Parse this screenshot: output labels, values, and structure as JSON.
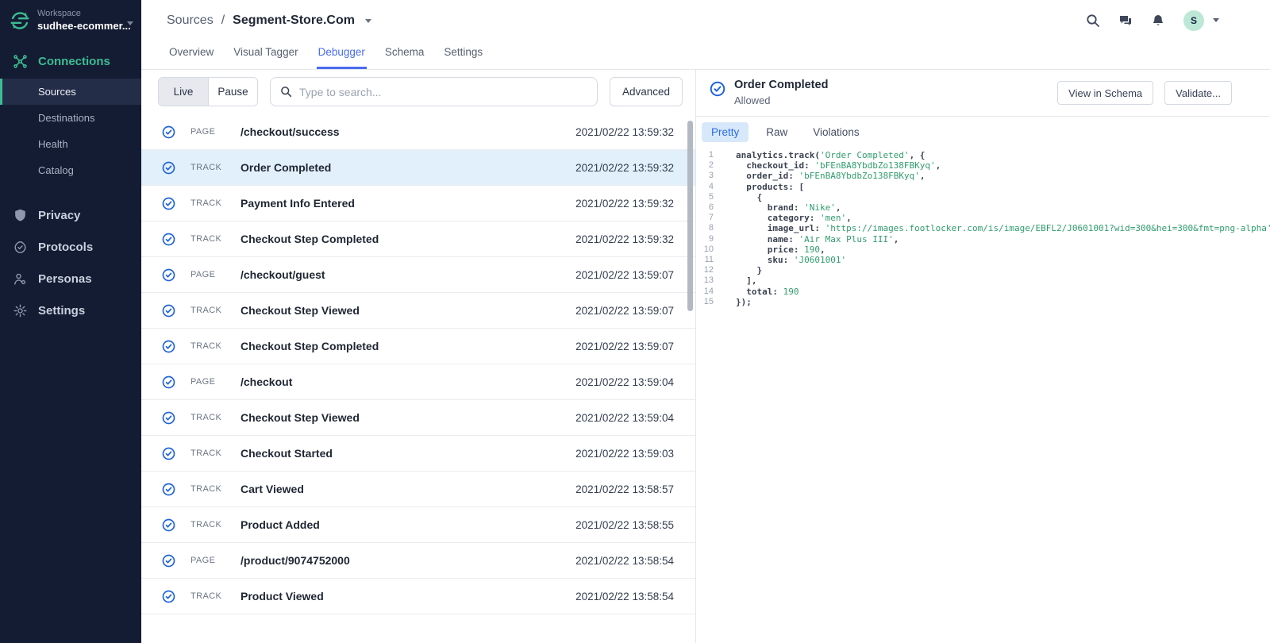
{
  "colors": {
    "sidebar_bg": "#141c33",
    "accent_green": "#3bbd92",
    "accent_blue": "#4a6cf0",
    "event_icon_blue": "#2064d8",
    "selected_row_bg": "#e2f0fb",
    "code_string_green": "#2f9d6c",
    "avatar_bg": "#bde7d6"
  },
  "sidebar": {
    "workspace_label": "Workspace",
    "workspace_name": "sudhee-ecommer...",
    "sections": [
      {
        "icon": "connections-icon",
        "label": "Connections",
        "active": true,
        "children": [
          {
            "label": "Sources",
            "selected": true
          },
          {
            "label": "Destinations"
          },
          {
            "label": "Health"
          },
          {
            "label": "Catalog"
          }
        ]
      },
      {
        "icon": "shield-icon",
        "label": "Privacy"
      },
      {
        "icon": "protocols-icon",
        "label": "Protocols"
      },
      {
        "icon": "personas-icon",
        "label": "Personas"
      },
      {
        "icon": "settings-icon",
        "label": "Settings"
      }
    ]
  },
  "header": {
    "breadcrumb": {
      "parent": "Sources",
      "separator": "/",
      "current": "Segment-Store.Com"
    },
    "tabs": [
      {
        "label": "Overview"
      },
      {
        "label": "Visual Tagger"
      },
      {
        "label": "Debugger",
        "active": true
      },
      {
        "label": "Schema"
      },
      {
        "label": "Settings"
      }
    ],
    "avatar_initial": "S"
  },
  "toolbar": {
    "live_label": "Live",
    "pause_label": "Pause",
    "search_placeholder": "Type to search...",
    "advanced_label": "Advanced"
  },
  "events": {
    "rows": [
      {
        "type": "PAGE",
        "name": "/checkout/success",
        "time": "2021/02/22 13:59:32"
      },
      {
        "type": "TRACK",
        "name": "Order Completed",
        "time": "2021/02/22 13:59:32",
        "selected": true
      },
      {
        "type": "TRACK",
        "name": "Payment Info Entered",
        "time": "2021/02/22 13:59:32"
      },
      {
        "type": "TRACK",
        "name": "Checkout Step Completed",
        "time": "2021/02/22 13:59:32"
      },
      {
        "type": "PAGE",
        "name": "/checkout/guest",
        "time": "2021/02/22 13:59:07"
      },
      {
        "type": "TRACK",
        "name": "Checkout Step Viewed",
        "time": "2021/02/22 13:59:07"
      },
      {
        "type": "TRACK",
        "name": "Checkout Step Completed",
        "time": "2021/02/22 13:59:07"
      },
      {
        "type": "PAGE",
        "name": "/checkout",
        "time": "2021/02/22 13:59:04"
      },
      {
        "type": "TRACK",
        "name": "Checkout Step Viewed",
        "time": "2021/02/22 13:59:04"
      },
      {
        "type": "TRACK",
        "name": "Checkout Started",
        "time": "2021/02/22 13:59:03"
      },
      {
        "type": "TRACK",
        "name": "Cart Viewed",
        "time": "2021/02/22 13:58:57"
      },
      {
        "type": "TRACK",
        "name": "Product Added",
        "time": "2021/02/22 13:58:55"
      },
      {
        "type": "PAGE",
        "name": "/product/9074752000",
        "time": "2021/02/22 13:58:54"
      },
      {
        "type": "TRACK",
        "name": "Product Viewed",
        "time": "2021/02/22 13:58:54"
      }
    ]
  },
  "detail": {
    "title": "Order Completed",
    "status": "Allowed",
    "view_in_schema_label": "View in Schema",
    "validate_label": "Validate...",
    "tabs": [
      {
        "label": "Pretty",
        "active": true
      },
      {
        "label": "Raw"
      },
      {
        "label": "Violations"
      }
    ]
  },
  "code": {
    "lines": [
      {
        "num": 1,
        "seg": [
          [
            "analytics.track(",
            "p"
          ],
          [
            "'Order Completed'",
            "s"
          ],
          [
            ", {",
            "p"
          ]
        ]
      },
      {
        "num": 2,
        "seg": [
          [
            "  checkout_id: ",
            "p"
          ],
          [
            "'bFEnBA8YbdbZo138FBKyq'",
            "s"
          ],
          [
            ",",
            "p"
          ]
        ]
      },
      {
        "num": 3,
        "seg": [
          [
            "  order_id: ",
            "p"
          ],
          [
            "'bFEnBA8YbdbZo138FBKyq'",
            "s"
          ],
          [
            ",",
            "p"
          ]
        ]
      },
      {
        "num": 4,
        "seg": [
          [
            "  products: [",
            "p"
          ]
        ]
      },
      {
        "num": 5,
        "seg": [
          [
            "    {",
            "p"
          ]
        ]
      },
      {
        "num": 6,
        "seg": [
          [
            "      brand: ",
            "p"
          ],
          [
            "'Nike'",
            "s"
          ],
          [
            ",",
            "p"
          ]
        ]
      },
      {
        "num": 7,
        "seg": [
          [
            "      category: ",
            "p"
          ],
          [
            "'men'",
            "s"
          ],
          [
            ",",
            "p"
          ]
        ]
      },
      {
        "num": 8,
        "seg": [
          [
            "      image_url: ",
            "p"
          ],
          [
            "'https://images.footlocker.com/is/image/EBFL2/J0601001?wid=300&hei=300&fmt=png-alpha'",
            "s"
          ],
          [
            ",",
            "p"
          ]
        ]
      },
      {
        "num": 9,
        "seg": [
          [
            "      name: ",
            "p"
          ],
          [
            "'Air Max Plus III'",
            "s"
          ],
          [
            ",",
            "p"
          ]
        ]
      },
      {
        "num": 10,
        "seg": [
          [
            "      price: ",
            "p"
          ],
          [
            "190",
            "n"
          ],
          [
            ",",
            "p"
          ]
        ]
      },
      {
        "num": 11,
        "seg": [
          [
            "      sku: ",
            "p"
          ],
          [
            "'J0601001'",
            "s"
          ]
        ]
      },
      {
        "num": 12,
        "seg": [
          [
            "    }",
            "p"
          ]
        ]
      },
      {
        "num": 13,
        "seg": [
          [
            "  ],",
            "p"
          ]
        ]
      },
      {
        "num": 14,
        "seg": [
          [
            "  total: ",
            "p"
          ],
          [
            "190",
            "n"
          ]
        ]
      },
      {
        "num": 15,
        "seg": [
          [
            "});",
            "p"
          ]
        ]
      }
    ]
  }
}
